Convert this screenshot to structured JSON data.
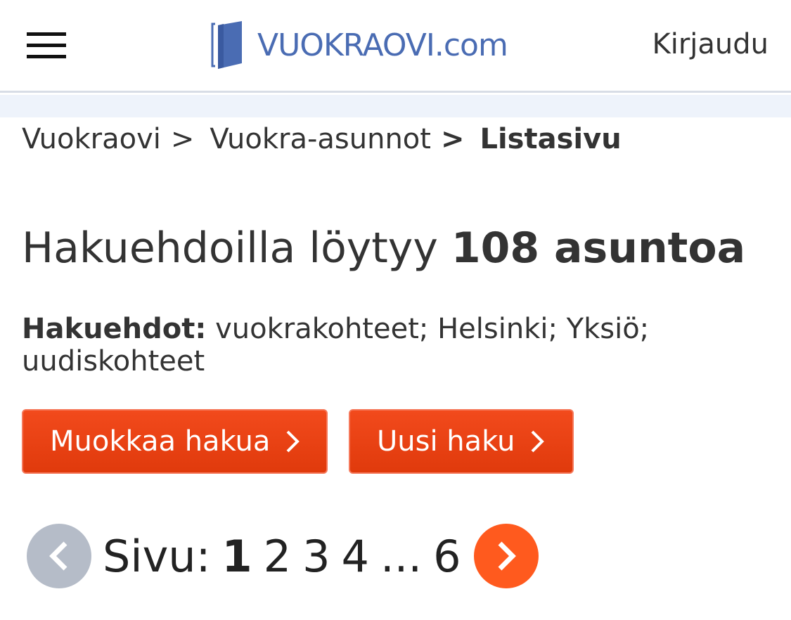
{
  "header": {
    "login_label": "Kirjaudu",
    "logo_text": "VUOKRAOVI",
    "logo_domain": ".com"
  },
  "breadcrumb": {
    "items": [
      "Vuokraovi",
      "Vuokra-asunnot",
      "Listasivu"
    ],
    "separator": ">"
  },
  "results": {
    "prefix": "Hakuehdoilla löytyy",
    "count_text": "108 asuntoa"
  },
  "criteria": {
    "label": "Hakuehdot:",
    "value": "vuokrakohteet; Helsinki; Yksiö; uudiskohteet"
  },
  "buttons": {
    "edit_label": "Muokkaa hakua",
    "new_label": "Uusi haku"
  },
  "pagination": {
    "label": "Sivu:",
    "current": "1",
    "pages": [
      "2",
      "3",
      "4"
    ],
    "ellipsis": "...",
    "last": "6"
  },
  "colors": {
    "brand_blue": "#4a6cb3",
    "accent_orange": "#ff5a1e",
    "button_red": "#e84214",
    "disabled_gray": "#b5bcc8"
  },
  "icons": {
    "menu": "hamburger-icon",
    "prev": "chevron-left-icon",
    "next": "chevron-right-icon",
    "button_arrow": "chevron-right-icon",
    "logo": "door-icon"
  }
}
